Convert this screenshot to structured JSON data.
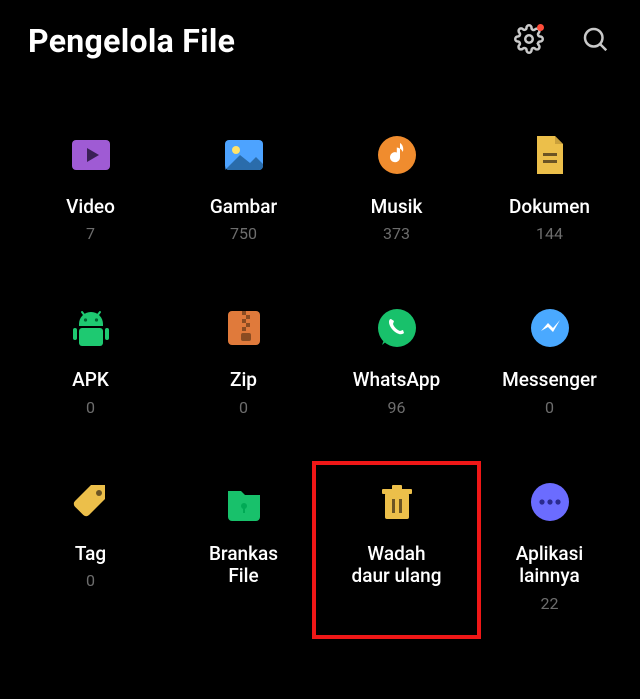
{
  "header": {
    "title": "Pengelola File"
  },
  "categories": [
    {
      "key": "video",
      "icon": "play",
      "label": "Video",
      "count": "7"
    },
    {
      "key": "gambar",
      "icon": "image",
      "label": "Gambar",
      "count": "750"
    },
    {
      "key": "musik",
      "icon": "music",
      "label": "Musik",
      "count": "373"
    },
    {
      "key": "dokumen",
      "icon": "doc",
      "label": "Dokumen",
      "count": "144"
    },
    {
      "key": "apk",
      "icon": "android",
      "label": "APK",
      "count": "0"
    },
    {
      "key": "zip",
      "icon": "zip",
      "label": "Zip",
      "count": "0"
    },
    {
      "key": "whatsapp",
      "icon": "whatsapp",
      "label": "WhatsApp",
      "count": "96"
    },
    {
      "key": "messenger",
      "icon": "messenger",
      "label": "Messenger",
      "count": "0"
    },
    {
      "key": "tag",
      "icon": "tag",
      "label": "Tag",
      "count": "0"
    },
    {
      "key": "brankas",
      "icon": "lock",
      "label": "Brankas\nFile",
      "count": ""
    },
    {
      "key": "recycle",
      "icon": "trash",
      "label": "Wadah\ndaur ulang",
      "count": ""
    },
    {
      "key": "lainnya",
      "icon": "more",
      "label": "Aplikasi\nlainnya",
      "count": "22"
    }
  ],
  "highlight": {
    "key": "recycle"
  },
  "colors": {
    "purple": "#9f5bd4",
    "blue": "#4da3ff",
    "orange": "#f08c2e",
    "yellow": "#ecbf4a",
    "green": "#1ec971",
    "lblue": "#4aa9ff",
    "teal": "#18c16b",
    "dorange": "#e07a3b",
    "lpurple": "#6b6cff"
  }
}
